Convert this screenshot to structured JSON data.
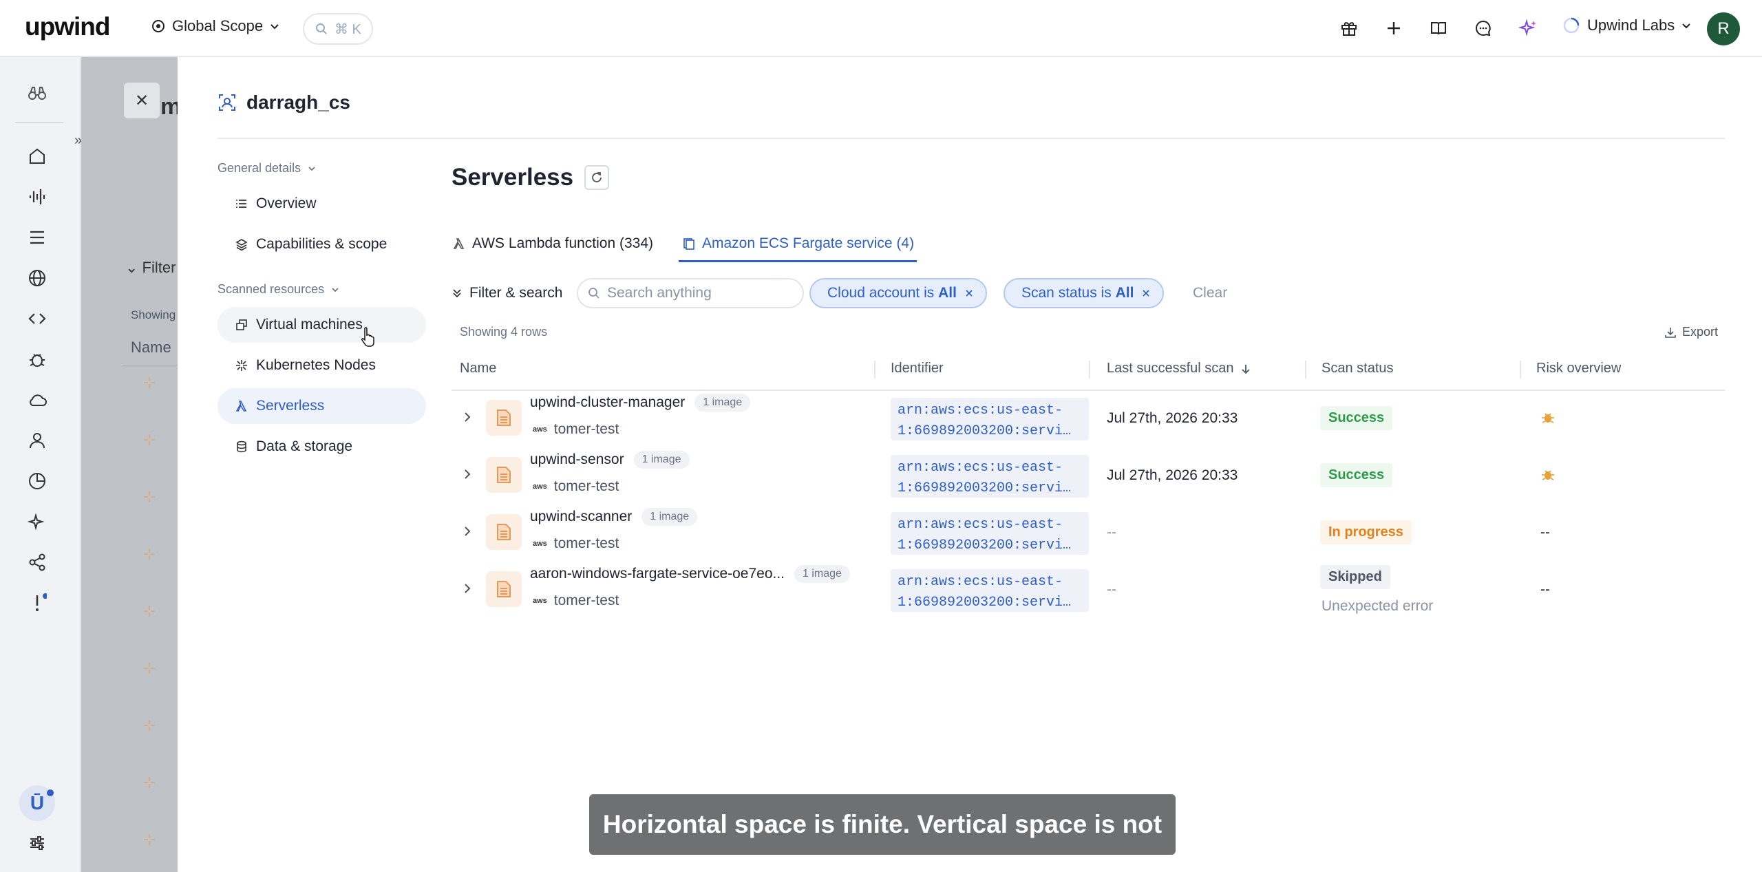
{
  "app": {
    "logo": "upwind",
    "scope": "Global Scope",
    "search_shortcut": "⌘ K",
    "org": "Upwind Labs",
    "avatar_initial": "R"
  },
  "background": {
    "title_fragment": "m",
    "filter_label": "Filter",
    "showing_fragment": "Showing",
    "name_col": "Name"
  },
  "panel": {
    "title": "darragh_cs",
    "nav": {
      "general_section": "General details",
      "general_items": [
        {
          "label": "Overview"
        },
        {
          "label": "Capabilities & scope"
        }
      ],
      "scanned_section": "Scanned resources",
      "scanned_items": [
        {
          "label": "Virtual machines"
        },
        {
          "label": "Kubernetes Nodes"
        },
        {
          "label": "Serverless"
        },
        {
          "label": "Data & storage"
        }
      ]
    },
    "heading": "Serverless",
    "tabs": [
      {
        "label": "AWS Lambda function (334)"
      },
      {
        "label": "Amazon ECS Fargate service (4)"
      }
    ],
    "filters": {
      "toggle_label": "Filter & search",
      "search_placeholder": "Search anything",
      "chips": [
        {
          "prefix": "Cloud account is ",
          "value": "All"
        },
        {
          "prefix": "Scan status is ",
          "value": "All"
        }
      ],
      "clear_label": "Clear"
    },
    "rows_count": "Showing 4 rows",
    "export_label": "Export",
    "columns": [
      "Name",
      "Identifier",
      "Last successful scan",
      "Scan status",
      "Risk overview"
    ],
    "rows": [
      {
        "name": "upwind-cluster-manager",
        "images": "1 image",
        "account": "tomer-test",
        "identifier_1": "arn:aws:ecs:us-east-",
        "identifier_2": "1:669892003200:servi…",
        "last_scan": "Jul 27th, 2026 20:33",
        "status": "Success",
        "status_sub": "",
        "risk": "bug"
      },
      {
        "name": "upwind-sensor",
        "images": "1 image",
        "account": "tomer-test",
        "identifier_1": "arn:aws:ecs:us-east-",
        "identifier_2": "1:669892003200:servi…",
        "last_scan": "Jul 27th, 2026 20:33",
        "status": "Success",
        "status_sub": "",
        "risk": "bug"
      },
      {
        "name": "upwind-scanner",
        "images": "1 image",
        "account": "tomer-test",
        "identifier_1": "arn:aws:ecs:us-east-",
        "identifier_2": "1:669892003200:servi…",
        "last_scan": "--",
        "status": "In progress",
        "status_sub": "",
        "risk": "--"
      },
      {
        "name": "aaron-windows-fargate-service-oe7eo...",
        "images": "1 image",
        "account": "tomer-test",
        "identifier_1": "arn:aws:ecs:us-east-",
        "identifier_2": "1:669892003200:servi…",
        "last_scan": "--",
        "status": "Skipped",
        "status_sub": "Unexpected error",
        "risk": "--"
      }
    ]
  },
  "caption": "Horizontal space is finite. Vertical space is not",
  "colors": {
    "accent": "#2f5fc4",
    "success": "#2e9a4a",
    "in_progress": "#e0821e",
    "risk_bug": "#e9a23b"
  }
}
